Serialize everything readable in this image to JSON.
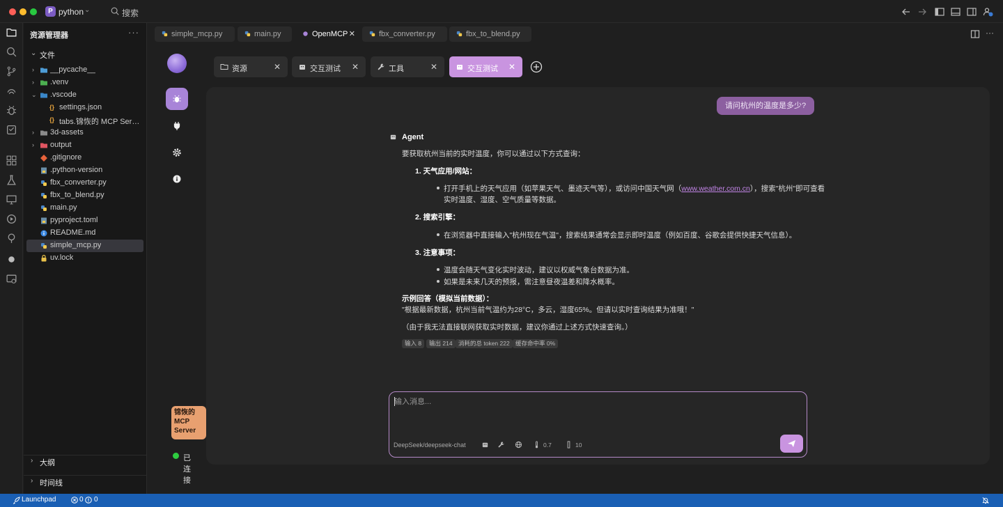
{
  "titlebar": {
    "project_badge": "P",
    "project_name": "python",
    "search_label": "搜索"
  },
  "sidebar": {
    "title": "资源管理器",
    "more": "···",
    "files_section": "文件",
    "outline_section": "大纲",
    "timeline_section": "时间线",
    "tree": [
      {
        "label": "__pycache__",
        "type": "folder"
      },
      {
        "label": ".venv",
        "type": "folder"
      },
      {
        "label": ".vscode",
        "type": "folder"
      },
      {
        "label": "settings.json",
        "type": "json"
      },
      {
        "label": "tabs.锦恢的 MCP Server...",
        "type": "json"
      },
      {
        "label": "3d-assets",
        "type": "folder"
      },
      {
        "label": "output",
        "type": "folder"
      },
      {
        "label": ".gitignore",
        "type": "git"
      },
      {
        "label": ".python-version",
        "type": "file"
      },
      {
        "label": "fbx_converter.py",
        "type": "python"
      },
      {
        "label": "fbx_to_blend.py",
        "type": "python"
      },
      {
        "label": "main.py",
        "type": "python"
      },
      {
        "label": "pyproject.toml",
        "type": "toml"
      },
      {
        "label": "README.md",
        "type": "info"
      },
      {
        "label": "simple_mcp.py",
        "type": "python"
      },
      {
        "label": "uv.lock",
        "type": "lock"
      }
    ]
  },
  "editor_tabs": [
    {
      "label": "simple_mcp.py"
    },
    {
      "label": "main.py"
    },
    {
      "label": "OpenMCP",
      "close": "✕"
    },
    {
      "label": "fbx_converter.py"
    },
    {
      "label": "fbx_to_blend.py"
    }
  ],
  "panel_tabs": [
    {
      "label": "资源",
      "close": "✕"
    },
    {
      "label": "交互测试",
      "close": "✕"
    },
    {
      "label": "工具",
      "close": "✕"
    },
    {
      "label": "交互测试",
      "close": "✕"
    }
  ],
  "server": {
    "name": "锦恢的 MCP Server",
    "status": "已连接"
  },
  "chat": {
    "user_message": "请问杭州的温度是多少?",
    "agent_name": "Agent",
    "intro": "要获取杭州当前的实时温度，你可以通过以下方式查询：",
    "s1_title": "1. 天气应用/网站：",
    "s1_b1_prefix": "打开手机上的天气应用（如苹果天气、墨迹天气等），或访问中国天气网（",
    "s1_b1_link": "www.weather.com.cn",
    "s1_b1_suffix": "），搜索\"杭州\"即可查看",
    "s1_b1_line2": "实时温度、湿度、空气质量等数据。",
    "s2_title": "2. 搜索引擎：",
    "s2_b1": "在浏览器中直接输入\"杭州现在气温\"，搜索结果通常会显示即时温度（例如百度、谷歌会提供快捷天气信息）。",
    "s3_title": "3. 注意事项：",
    "s3_b1": "温度会随天气变化实时波动，建议以权威气象台数据为准。",
    "s3_b2": "如果是未来几天的预报，需注意昼夜温差和降水概率。",
    "example_title": "示例回答（模拟当前数据）：",
    "example_text": "\"根据最新数据，杭州当前气温约为28°C，多云，湿度65%。但请以实时查询结果为准哦！\"",
    "note": "（由于我无法直接联网获取实时数据，建议你通过上述方式快速查询。）",
    "stats": [
      "输入 8",
      "输出 214",
      "消耗的总 token 222",
      "缓存命中率 0%"
    ]
  },
  "composer": {
    "placeholder": "输入消息...",
    "model": "DeepSeek/deepseek-chat",
    "temperature": "0.7",
    "context_len": "10"
  },
  "statusbar": {
    "launchpad": "Launchpad",
    "errors": "0",
    "warnings": "0"
  },
  "colors": {
    "accent": "#c994e0",
    "user_bubble": "#8c5fa0",
    "server_badge": "#e8a070",
    "status_connected": "#2ecc40",
    "statusbar": "#1a5fb4"
  }
}
